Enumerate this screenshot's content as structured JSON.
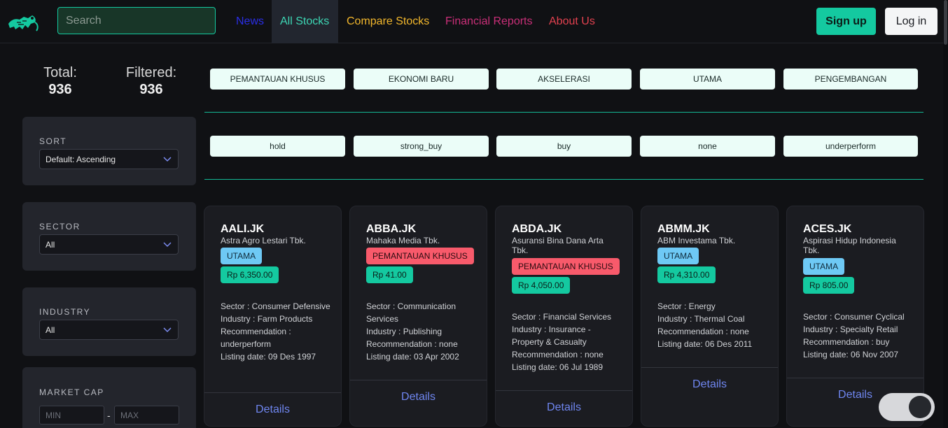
{
  "header": {
    "search_placeholder": "Search",
    "nav": [
      {
        "label": "News",
        "color": "#2a2ee6"
      },
      {
        "label": "All Stocks",
        "color": "#3dd6b4"
      },
      {
        "label": "Compare Stocks",
        "color": "#f2b72c"
      },
      {
        "label": "Financial Reports",
        "color": "#c92f78"
      },
      {
        "label": "About Us",
        "color": "#e2414f"
      }
    ],
    "signup_label": "Sign up",
    "login_label": "Log in"
  },
  "stats": {
    "total_label": "Total:",
    "total_value": "936",
    "filtered_label": "Filtered:",
    "filtered_value": "936"
  },
  "filters": {
    "sort_label": "SORT",
    "sort_value": "Default: Ascending",
    "sector_label": "SECTOR",
    "sector_value": "All",
    "industry_label": "INDUSTRY",
    "industry_value": "All",
    "marketcap_label": "MARKET CAP",
    "marketcap_min_placeholder": "MIN",
    "marketcap_max_placeholder": "MAX",
    "marketcap_separator": "-"
  },
  "board_chips": [
    "PEMANTAUAN KHUSUS",
    "EKONOMI BARU",
    "AKSELERASI",
    "UTAMA",
    "PENGEMBANGAN"
  ],
  "recommendation_chips": [
    "hold",
    "strong_buy",
    "buy",
    "none",
    "underperform"
  ],
  "cards": [
    {
      "ticker": "AALI.JK",
      "name": "Astra Agro Lestari Tbk.",
      "board": "UTAMA",
      "price": "Rp 6,350.00",
      "sector": "Sector : Consumer Defensive",
      "industry": "Industry : Farm Products",
      "recommendation": "Recommendation : underperform",
      "listing": "Listing date: 09 Des 1997",
      "details": "Details"
    },
    {
      "ticker": "ABBA.JK",
      "name": "Mahaka Media Tbk.",
      "board": "PEMANTAUAN KHUSUS",
      "price": "Rp 41.00",
      "sector": "Sector : Communication Services",
      "industry": "Industry : Publishing",
      "recommendation": "Recommendation : none",
      "listing": "Listing date: 03 Apr 2002",
      "details": "Details"
    },
    {
      "ticker": "ABDA.JK",
      "name": "Asuransi Bina Dana Arta Tbk.",
      "board": "PEMANTAUAN KHUSUS",
      "price": "Rp 4,050.00",
      "sector": "Sector : Financial Services",
      "industry": "Industry : Insurance - Property & Casualty",
      "recommendation": "Recommendation : none",
      "listing": "Listing date: 06 Jul 1989",
      "details": "Details"
    },
    {
      "ticker": "ABMM.JK",
      "name": "ABM Investama Tbk.",
      "board": "UTAMA",
      "price": "Rp 4,310.00",
      "sector": "Sector : Energy",
      "industry": "Industry : Thermal Coal",
      "recommendation": "Recommendation : none",
      "listing": "Listing date: 06 Des 2011",
      "details": "Details"
    },
    {
      "ticker": "ACES.JK",
      "name": "Aspirasi Hidup Indonesia Tbk.",
      "board": "UTAMA",
      "price": "Rp 805.00",
      "sector": "Sector : Consumer Cyclical",
      "industry": "Industry : Specialty Retail",
      "recommendation": "Recommendation : buy",
      "listing": "Listing date: 06 Nov 2007",
      "details": "Details"
    }
  ],
  "theme_toggle": {
    "state": "dark"
  }
}
